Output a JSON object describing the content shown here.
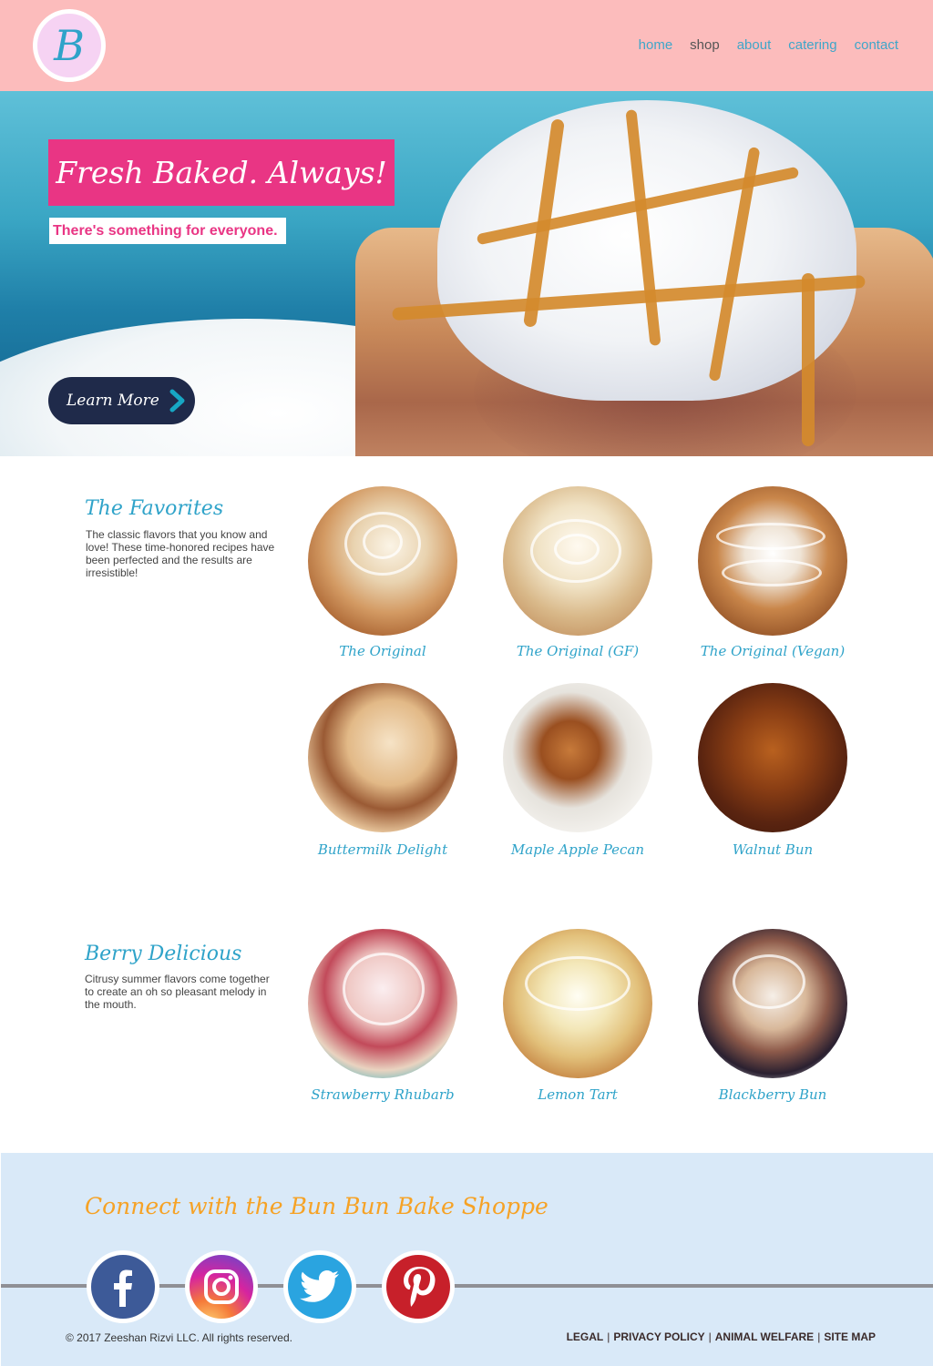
{
  "header": {
    "logo_letter": "B",
    "nav": [
      {
        "label": "home",
        "active": false
      },
      {
        "label": "shop",
        "active": true
      },
      {
        "label": "about",
        "active": false
      },
      {
        "label": "catering",
        "active": false
      },
      {
        "label": "contact",
        "active": false
      }
    ]
  },
  "hero": {
    "title": "Fresh Baked. Always!",
    "subtitle": "There's something for everyone.",
    "button_label": "Learn More"
  },
  "favorites": {
    "title": "The Favorites",
    "description": "The classic flavors that you know and love! These time-honored recipes have been perfected and the results are irresistible!",
    "products": [
      {
        "name": "The Original"
      },
      {
        "name": "The Original (GF)"
      },
      {
        "name": "The Original (Vegan)"
      },
      {
        "name": "Buttermilk Delight"
      },
      {
        "name": "Maple Apple Pecan"
      },
      {
        "name": "Walnut Bun"
      }
    ]
  },
  "berry": {
    "title": "Berry Delicious",
    "description": "Citrusy summer flavors come together to create an oh so pleasant melody in the mouth.",
    "products": [
      {
        "name": "Strawberry Rhubarb"
      },
      {
        "name": "Lemon Tart"
      },
      {
        "name": "Blackberry Bun"
      }
    ]
  },
  "footer": {
    "title": "Connect with the Bun Bun Bake Shoppe",
    "social": [
      {
        "icon": "facebook-icon"
      },
      {
        "icon": "instagram-icon"
      },
      {
        "icon": "twitter-icon"
      },
      {
        "icon": "pinterest-icon"
      }
    ],
    "copyright": "© 2017 Zeeshan Rizvi LLC. All rights reserved.",
    "links": [
      "LEGAL",
      "PRIVACY POLICY",
      "ANIMAL WELFARE",
      "SITE MAP"
    ],
    "separator": "|"
  },
  "colors": {
    "header_bg": "#fcbcbc",
    "accent_pink": "#e93584",
    "accent_blue": "#2fa3c9",
    "button_navy": "#1f2a4a",
    "footer_bg": "#d9e9f8",
    "footer_title": "#f6a225"
  }
}
